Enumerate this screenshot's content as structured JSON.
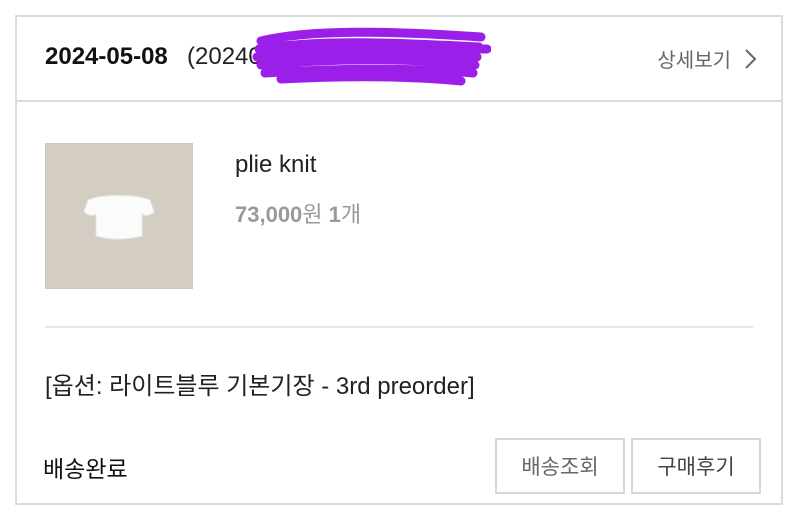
{
  "order": {
    "date": "2024-05-08",
    "number": "(20240508",
    "detail_label": "상세보기"
  },
  "product": {
    "name": "plie knit",
    "price_value": "73,000",
    "price_unit": "원",
    "qty_value": "1",
    "qty_unit": "개",
    "option": "[옵션: 라이트블루 기본기장 - 3rd preorder]"
  },
  "footer": {
    "status": "배송완료",
    "track_label": "배송조회",
    "review_label": "구매후기"
  },
  "icons": {
    "detail_chevron": "chevron-right-icon",
    "redaction": "scribble-redaction"
  },
  "colors": {
    "redaction": "#9b1fe8",
    "image_bg": "#d3cdc3",
    "border": "#dcdcdc"
  }
}
